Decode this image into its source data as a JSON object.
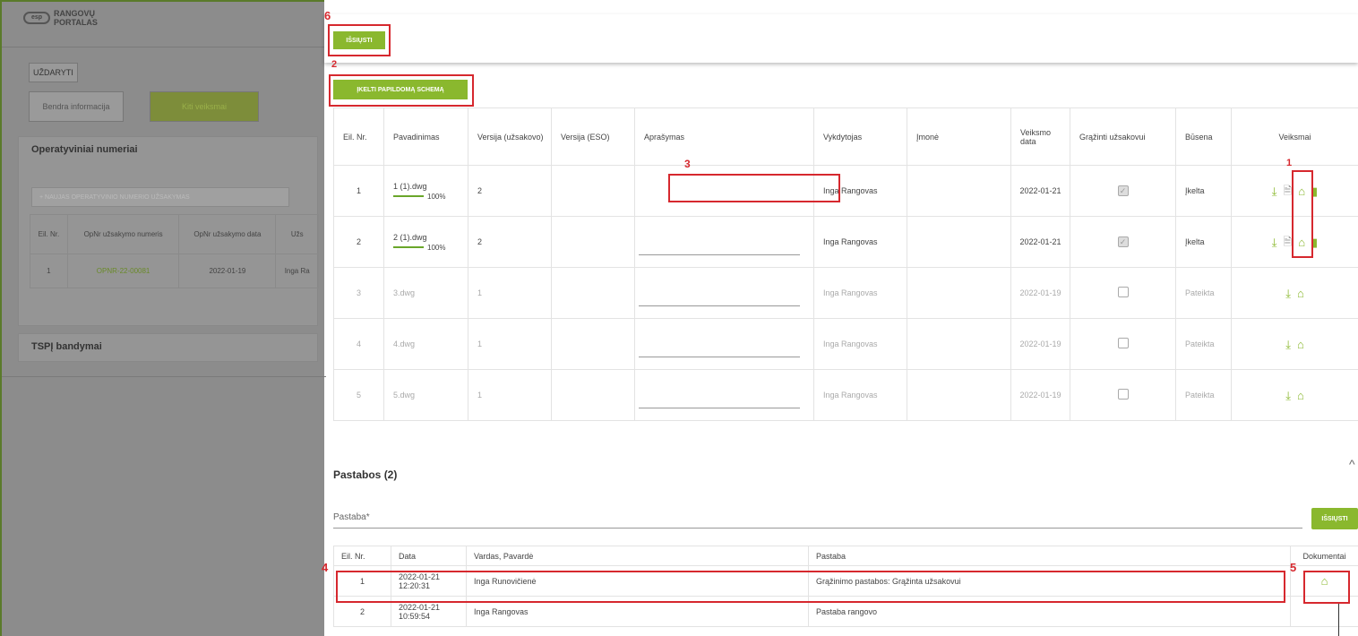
{
  "left": {
    "logo_icon": "esp-logo-icon",
    "logo_line1": "RANGOVŲ",
    "logo_line2": "PORTALAS",
    "close_label": "UŽDARYTI",
    "tab_general": "Bendra informacija",
    "tab_other": "Kiti veiksmai",
    "panel1_title": "Operatyviniai numeriai",
    "add_button": "+ NAUJAS OPERATYVINIO NUMERIO UŽSAKYMAS",
    "table_headers": [
      "Eil. Nr.",
      "OpNr užsakymo numeris",
      "OpNr užsakymo data",
      "Užs"
    ],
    "table_row": [
      "1",
      "OPNR-22-00081",
      "2022-01-19",
      "Inga Ra"
    ],
    "panel2_title": "TSPĮ bandymai"
  },
  "toolbar": {
    "send_label": "IŠSIŲSTI",
    "upload_label": "ĮKELTI PAPILDOMĄ SCHEMĄ"
  },
  "markers": {
    "m1": "1",
    "m2": "2",
    "m3": "3",
    "m4": "4",
    "m5": "5",
    "m6": "6"
  },
  "files": {
    "headers": [
      "Eil. Nr.",
      "Pavadinimas",
      "Versija (užsakovo)",
      "Versija (ESO)",
      "Aprašymas",
      "Vykdytojas",
      "Įmonė",
      "Veiksmo data",
      "Grąžinti užsakovui",
      "Būsena",
      "Veiksmai"
    ],
    "rows": [
      {
        "nr": "1",
        "name": "1 (1).dwg",
        "progress": "100%",
        "ver": "2",
        "exec": "Inga Rangovas",
        "date": "2022-01-21",
        "returned": true,
        "status": "Įkelta"
      },
      {
        "nr": "2",
        "name": "2 (1).dwg",
        "progress": "100%",
        "ver": "2",
        "exec": "Inga Rangovas",
        "date": "2022-01-21",
        "returned": true,
        "status": "Įkelta"
      },
      {
        "nr": "3",
        "name": "3.dwg",
        "ver": "1",
        "exec": "Inga Rangovas",
        "date": "2022-01-19",
        "returned": false,
        "status": "Pateikta"
      },
      {
        "nr": "4",
        "name": "4.dwg",
        "ver": "1",
        "exec": "Inga Rangovas",
        "date": "2022-01-19",
        "returned": false,
        "status": "Pateikta"
      },
      {
        "nr": "5",
        "name": "5.dwg",
        "ver": "1",
        "exec": "Inga Rangovas",
        "date": "2022-01-19",
        "returned": false,
        "status": "Pateikta"
      }
    ]
  },
  "notes": {
    "title": "Pastabos (2)",
    "input_placeholder": "Pastaba*",
    "send_label": "IŠSIŲSTI",
    "headers": [
      "Eil. Nr.",
      "Data",
      "Vardas, Pavardė",
      "Pastaba",
      "Dokumentai"
    ],
    "rows": [
      {
        "nr": "1",
        "date": "2022-01-21",
        "time": "12:20:31",
        "name": "Inga Runovičienė",
        "note": "Grąžinimo pastabos: Grąžinta užsakovui",
        "has_doc": true
      },
      {
        "nr": "2",
        "date": "2022-01-21",
        "time": "10:59:54",
        "name": "Inga Rangovas",
        "note": "Pastaba rangovo",
        "has_doc": false
      }
    ]
  },
  "colors": {
    "accent": "#8ab82e",
    "marker": "#d6282e"
  }
}
